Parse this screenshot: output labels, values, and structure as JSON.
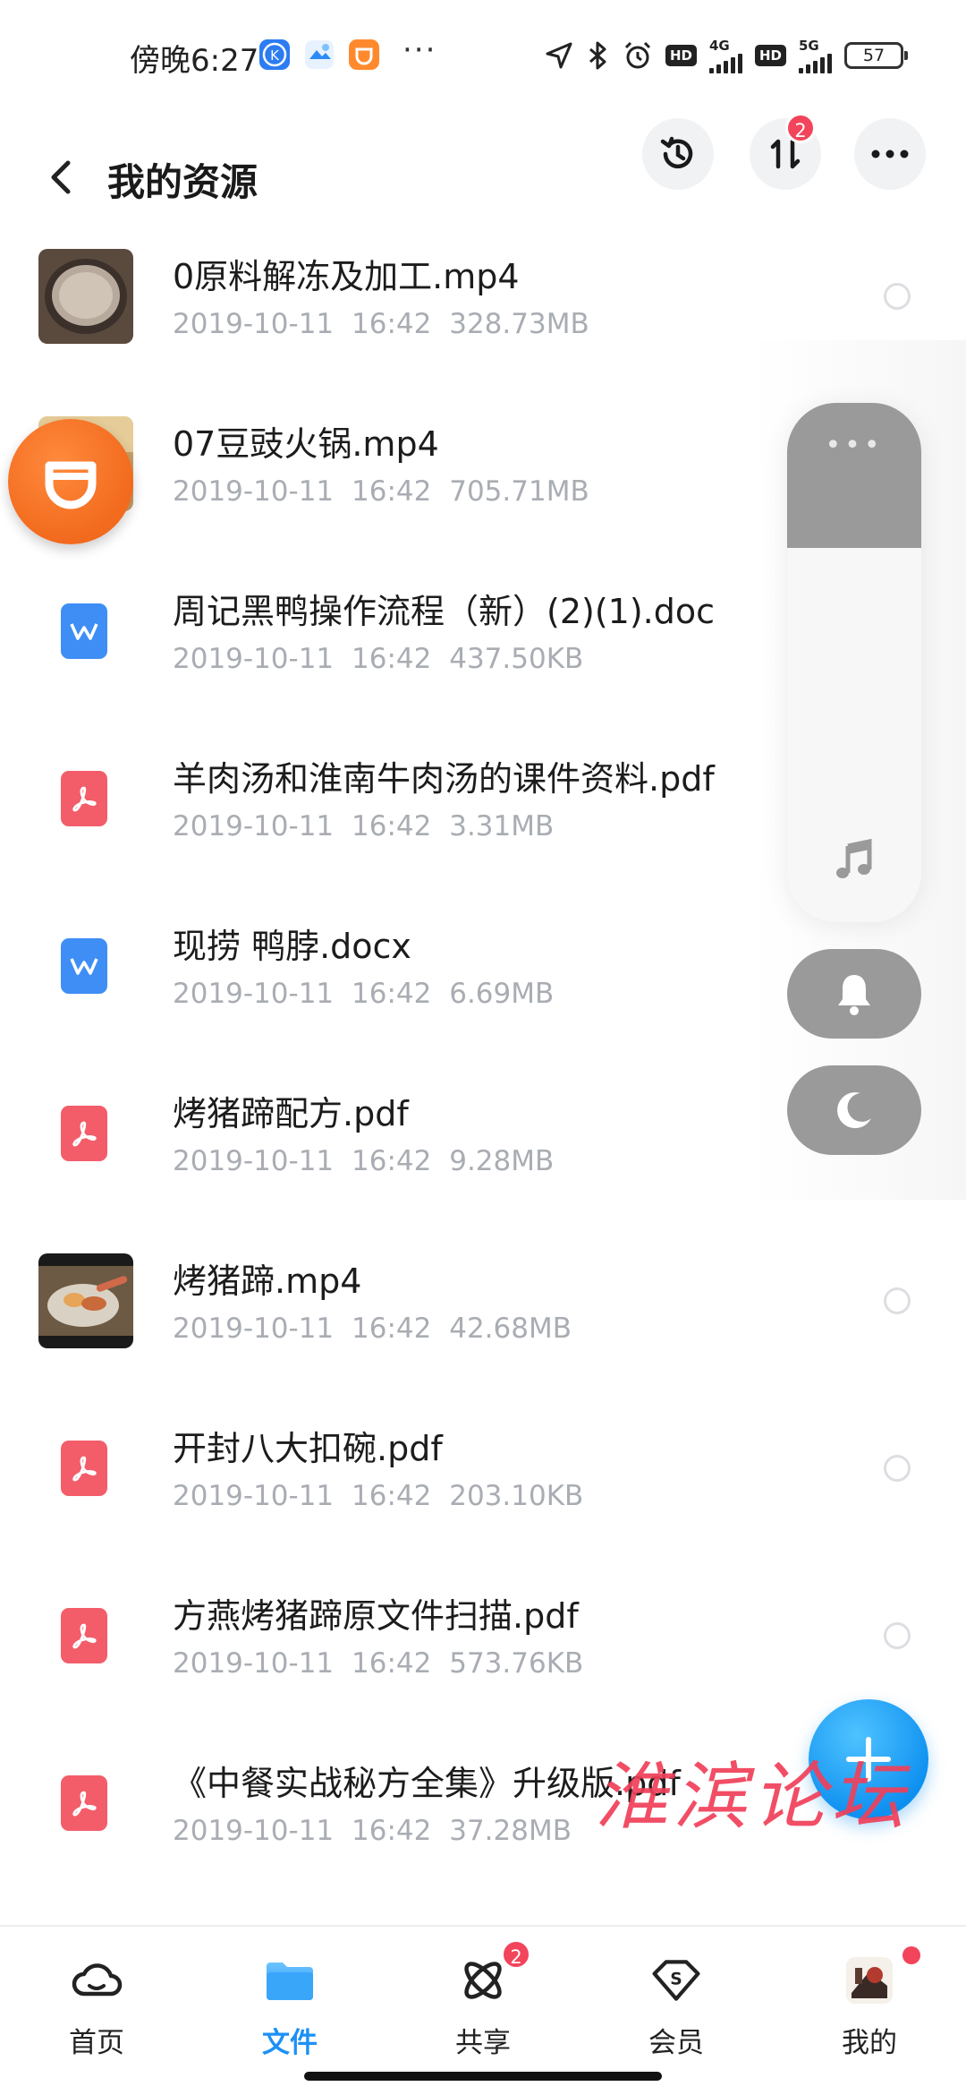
{
  "status_bar": {
    "time": "傍晚6:27",
    "dots": "···",
    "hd1": "HD",
    "net1": "4G",
    "hd2": "HD",
    "net2": "5G",
    "battery": "57"
  },
  "header": {
    "title": "我的资源",
    "transfer_badge": "2"
  },
  "files": [
    {
      "name": "0原料解冻及加工.mp4",
      "date": "2019-10-11",
      "time": "16:42",
      "size": "328.73MB",
      "type": "video"
    },
    {
      "name": "07豆豉火锅.mp4",
      "date": "2019-10-11",
      "time": "16:42",
      "size": "705.71MB",
      "type": "video"
    },
    {
      "name": "周记黑鸭操作流程（新）(2)(1).doc",
      "date": "2019-10-11",
      "time": "16:42",
      "size": "437.50KB",
      "type": "word"
    },
    {
      "name": "羊肉汤和淮南牛肉汤的课件资料.pdf",
      "date": "2019-10-11",
      "time": "16:42",
      "size": "3.31MB",
      "type": "pdf"
    },
    {
      "name": "现捞 鸭脖.docx",
      "date": "2019-10-11",
      "time": "16:42",
      "size": "6.69MB",
      "type": "word"
    },
    {
      "name": "烤猪蹄配方.pdf",
      "date": "2019-10-11",
      "time": "16:42",
      "size": "9.28MB",
      "type": "pdf"
    },
    {
      "name": "烤猪蹄.mp4",
      "date": "2019-10-11",
      "time": "16:42",
      "size": "42.68MB",
      "type": "video"
    },
    {
      "name": "开封八大扣碗.pdf",
      "date": "2019-10-11",
      "time": "16:42",
      "size": "203.10KB",
      "type": "pdf"
    },
    {
      "name": "方燕烤猪蹄原文件扫描.pdf",
      "date": "2019-10-11",
      "time": "16:42",
      "size": "573.76KB",
      "type": "pdf"
    },
    {
      "name": "《中餐实战秘方全集》升级版.pdf",
      "date": "2019-10-11",
      "time": "16:42",
      "size": "37.28MB",
      "type": "pdf"
    }
  ],
  "volume_panel": {
    "level": 0.28,
    "dots": "•••"
  },
  "watermark": "淮滨论坛",
  "nav": {
    "items": [
      {
        "label": "首页",
        "icon": "cloud-icon",
        "active": false
      },
      {
        "label": "文件",
        "icon": "folder-icon",
        "active": true
      },
      {
        "label": "共享",
        "icon": "share-atom-icon",
        "active": false,
        "badge": "2"
      },
      {
        "label": "会员",
        "icon": "vip-diamond-icon",
        "active": false
      },
      {
        "label": "我的",
        "icon": "avatar",
        "active": false
      }
    ]
  },
  "colors": {
    "accent": "#1d90f5",
    "badge": "#f2445b",
    "pdf": "#f35d6a",
    "word": "#3f8ef5",
    "watermark": "#f0405a"
  }
}
